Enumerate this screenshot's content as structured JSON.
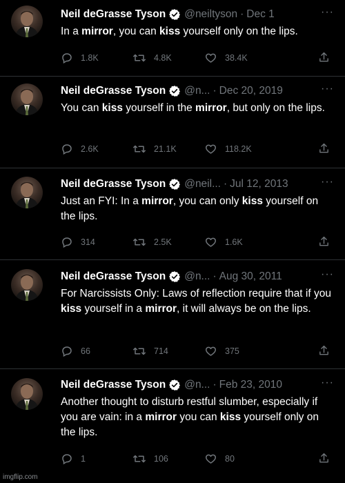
{
  "tweets": [
    {
      "name": "Neil deGrasse Tyson",
      "handle": "@neiltyson",
      "sep": "·",
      "date": "Dec 1",
      "text": [
        {
          "t": "In a ",
          "b": false
        },
        {
          "t": "mirror",
          "b": true
        },
        {
          "t": ", you can ",
          "b": false
        },
        {
          "t": "kiss",
          "b": true
        },
        {
          "t": " yourself only on the lips.",
          "b": false
        }
      ],
      "replies": "1.8K",
      "retweets": "4.8K",
      "likes": "38.4K"
    },
    {
      "name": "Neil deGrasse Tyson",
      "handle": "@n...",
      "sep": "·",
      "date": "Dec 20, 2019",
      "text": [
        {
          "t": "You can ",
          "b": false
        },
        {
          "t": "kiss",
          "b": true
        },
        {
          "t": " yourself in the ",
          "b": false
        },
        {
          "t": "mirror",
          "b": true
        },
        {
          "t": ", but only on the lips.",
          "b": false
        }
      ],
      "replies": "2.6K",
      "retweets": "21.1K",
      "likes": "118.2K"
    },
    {
      "name": "Neil deGrasse Tyson",
      "handle": "@neil...",
      "sep": "·",
      "date": "Jul 12, 2013",
      "text": [
        {
          "t": "Just an FYI:  In a ",
          "b": false
        },
        {
          "t": "mirror",
          "b": true
        },
        {
          "t": ", you can only ",
          "b": false
        },
        {
          "t": "kiss",
          "b": true
        },
        {
          "t": " yourself on the lips.",
          "b": false
        }
      ],
      "replies": "314",
      "retweets": "2.5K",
      "likes": "1.6K"
    },
    {
      "name": "Neil deGrasse Tyson",
      "handle": "@n...",
      "sep": "·",
      "date": "Aug 30, 2011",
      "text": [
        {
          "t": "For Narcissists Only: Laws of reflection require that if you ",
          "b": false
        },
        {
          "t": "kiss",
          "b": true
        },
        {
          "t": " yourself in a ",
          "b": false
        },
        {
          "t": "mirror",
          "b": true
        },
        {
          "t": ", it will always be on the lips.",
          "b": false
        }
      ],
      "replies": "66",
      "retweets": "714",
      "likes": "375"
    },
    {
      "name": "Neil deGrasse Tyson",
      "handle": "@n...",
      "sep": "·",
      "date": "Feb 23, 2010",
      "text": [
        {
          "t": "Another thought to disturb restful slumber, especially if you are vain: in a ",
          "b": false
        },
        {
          "t": "mirror",
          "b": true
        },
        {
          "t": " you can ",
          "b": false
        },
        {
          "t": "kiss",
          "b": true
        },
        {
          "t": " yourself only on the lips.",
          "b": false
        }
      ],
      "replies": "1",
      "retweets": "106",
      "likes": "80"
    }
  ],
  "more_label": "···",
  "watermark": "imgflip.com",
  "colors": {
    "background": "#000000",
    "text": "#ffffff",
    "muted": "#71767b",
    "verified": "#1d9bf0",
    "divider": "#2f3336"
  },
  "icons": {
    "reply": "reply-icon",
    "retweet": "retweet-icon",
    "like": "heart-icon",
    "share": "share-icon",
    "verified": "verified-badge-icon",
    "more": "more-options-icon"
  }
}
